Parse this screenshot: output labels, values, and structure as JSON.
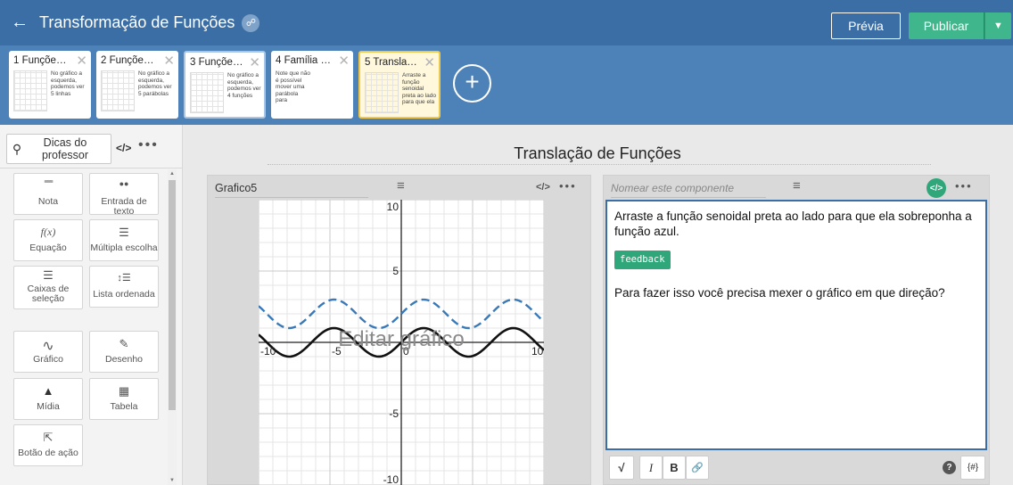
{
  "topbar": {
    "back_icon": "arrow-left-icon",
    "title": "Transformação de Funções",
    "link_icon": "link-icon",
    "preview_label": "Prévia",
    "publish_label": "Publicar",
    "dropdown_icon": "caret-down-icon",
    "colors": {
      "bar": "#3a6ea5",
      "publish": "#3fb68b"
    }
  },
  "slides": [
    {
      "name": "1 Funçõe…",
      "thumb_text": "No gráfico a esquerda, podemos ver 5 linhas"
    },
    {
      "name": "2 Funçõe…",
      "thumb_text": "No gráfico a esquerda, podemos ver 5 parábolas"
    },
    {
      "name": "3 Funçõe…",
      "thumb_text": "No gráfico a esquerda, podemos ver 4 funções"
    },
    {
      "name": "4 Família …",
      "thumb_text": "Note que não é possível mover uma parábola para"
    },
    {
      "name": "5 Transla…",
      "thumb_text": "Arraste a função senoidal preta ao lado para que ela"
    }
  ],
  "slide_close_glyph": "✕",
  "add_slide_glyph": "+",
  "left_panel": {
    "tips_label": "Dicas do professor",
    "code_glyph": "</>",
    "more_glyph": "•••",
    "components": [
      {
        "label": "Nota",
        "icon": "note-icon",
        "glyph": "≡≡≡"
      },
      {
        "label": "Entrada de texto",
        "icon": "text-input-icon",
        "glyph": "●●"
      },
      {
        "label": "Equação",
        "icon": "equation-icon",
        "glyph": "f(x)"
      },
      {
        "label": "Múltipla escolha",
        "icon": "multiple-choice-icon",
        "glyph": "☰"
      },
      {
        "label": "Caixas de seleção",
        "icon": "checkboxes-icon",
        "glyph": "☰"
      },
      {
        "label": "Lista ordenada",
        "icon": "ordered-list-icon",
        "glyph": "↕☰"
      },
      {
        "label": "Gráfico",
        "icon": "graph-icon",
        "glyph": "∿"
      },
      {
        "label": "Desenho",
        "icon": "drawing-icon",
        "glyph": "✎"
      },
      {
        "label": "Mídia",
        "icon": "media-icon",
        "glyph": "▲"
      },
      {
        "label": "Tabela",
        "icon": "table-icon",
        "glyph": "▦"
      },
      {
        "label": "Botão de ação",
        "icon": "action-button-icon",
        "glyph": "⇱"
      }
    ]
  },
  "main": {
    "page_title": "Translação de Funções",
    "graph_card": {
      "name": "Grafico5",
      "menu_glyph": "≡",
      "code_glyph": "</>",
      "more_glyph": "•••",
      "overlay_text": "Editar gráfico",
      "axes": {
        "x_ticks": [
          "-10",
          "-5",
          "0",
          "10"
        ],
        "y_ticks": [
          "10",
          "5",
          "-5",
          "-10"
        ],
        "xlim": [
          -10,
          10
        ],
        "ylim": [
          -10,
          10
        ]
      },
      "curves": [
        {
          "style": "dashed",
          "color": "#3a79b7",
          "amplitude": 1,
          "offset": 2
        },
        {
          "style": "solid",
          "color": "#111111",
          "amplitude": 1,
          "offset": 0
        }
      ]
    },
    "text_card": {
      "name_placeholder": "Nomear este componente",
      "menu_glyph": "≡",
      "code_glyph": "</>",
      "more_glyph": "•••",
      "prompt": "Arraste a função senoidal preta ao lado para que ela sobreponha a função azul.",
      "feedback_tag": "feedback",
      "question": "Para fazer isso você precisa mexer o gráfico em que direção?",
      "toolbar": {
        "sqrt_glyph": "√",
        "italic_glyph": "I",
        "bold_glyph": "B",
        "link_glyph": "🔗",
        "help_glyph": "?",
        "var_glyph": "{#}"
      }
    }
  }
}
